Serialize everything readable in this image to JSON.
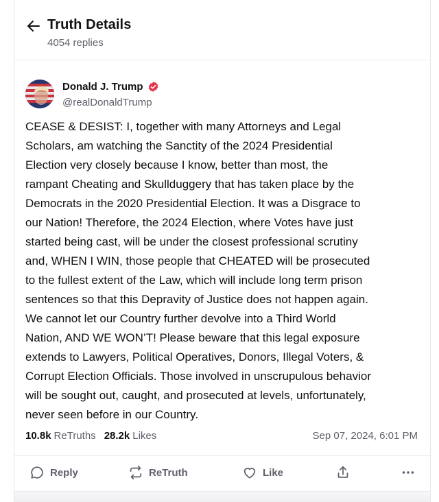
{
  "header": {
    "title": "Truth Details",
    "subtitle": "4054 replies"
  },
  "author": {
    "name": "Donald J. Trump",
    "handle": "@realDonaldTrump",
    "verified": true,
    "verified_color": "#e5354c"
  },
  "post": {
    "text": "CEASE & DESIST: I, together with many Attorneys and Legal\nScholars, am watching the Sanctity of the 2024 Presidential\nElection very closely because I know, better than most, the\nrampant Cheating and Skullduggery that has taken place by the\nDemocrats in the 2020 Presidential Election. It was a Disgrace to\nour Nation! Therefore, the 2024 Election, where Votes have just\nstarted being cast, will be under the closest professional scrutiny\nand, WHEN I WIN, those people that CHEATED will be prosecuted\nto the fullest extent of the Law, which will include long term prison\nsentences so that this Depravity of Justice does not happen again.\nWe cannot let our Country further devolve into a Third World\nNation, AND WE WON’T! Please beware that this legal exposure\nextends to Lawyers, Political Operatives, Donors, Illegal Voters, &\nCorrupt Election Officials. Those involved in unscrupulous behavior\nwill be sought out, caught, and prosecuted at levels, unfortunately,\nnever seen before in our Country.",
    "retruths_count": "10.8k",
    "retruths_label": "ReTruths",
    "likes_count": "28.2k",
    "likes_label": "Likes",
    "date": "Sep 07, 2024, 6:01 PM"
  },
  "actions": {
    "reply": "Reply",
    "retruth": "ReTruth",
    "like": "Like"
  },
  "icons": {
    "back": "arrow-left-icon",
    "verified": "verified-badge-icon",
    "reply": "reply-bubble-icon",
    "retruth": "retruth-arrows-icon",
    "like": "heart-icon",
    "share": "share-icon",
    "more": "more-dots-icon"
  }
}
